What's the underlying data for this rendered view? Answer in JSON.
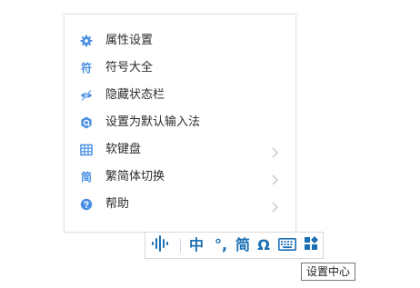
{
  "menu": {
    "items": [
      {
        "label": "属性设置",
        "icon": "gear-icon",
        "has_submenu": false
      },
      {
        "label": "符号大全",
        "icon": "symbol-glyph-icon",
        "glyph": "符",
        "has_submenu": false
      },
      {
        "label": "隐藏状态栏",
        "icon": "eye-hidden-icon",
        "has_submenu": false
      },
      {
        "label": "设置为默认输入法",
        "icon": "default-ime-icon",
        "has_submenu": false
      },
      {
        "label": "软键盘",
        "icon": "grid-icon",
        "has_submenu": true
      },
      {
        "label": "繁简体切换",
        "icon": "simplified-glyph-icon",
        "glyph": "简",
        "has_submenu": true
      },
      {
        "label": "帮助",
        "icon": "help-icon",
        "has_submenu": true
      }
    ]
  },
  "toolbar": {
    "voice_icon": "voice-waveform-icon",
    "mode_label": "中",
    "punct_label": "°,",
    "script_label": "简",
    "symbol_label": "Ω",
    "keyboard_icon": "keyboard-icon",
    "settings_icon": "settings-center-icon"
  },
  "tooltip": {
    "text": "设置中心"
  },
  "colors": {
    "menu_icon_blue": "#4a90e2",
    "toolbar_blue": "#1a6fb5",
    "text": "#2b2b2b"
  }
}
